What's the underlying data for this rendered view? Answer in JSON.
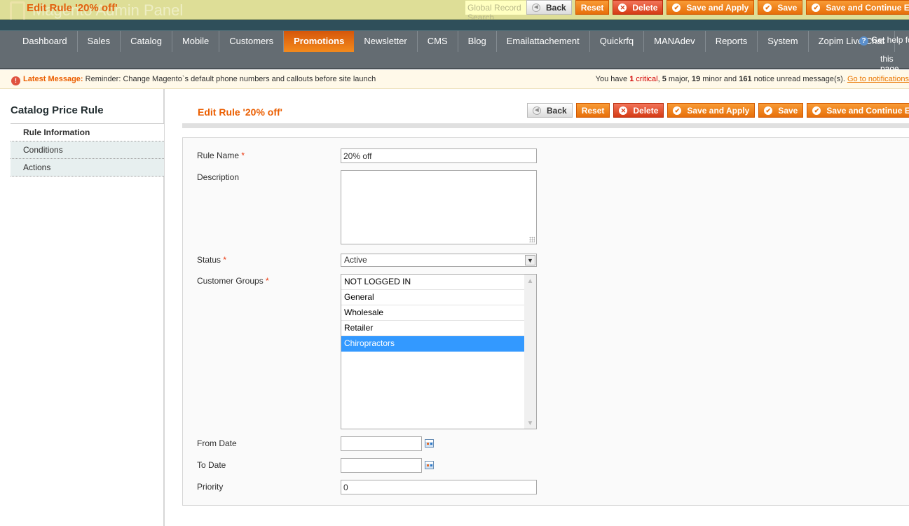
{
  "header": {
    "logo_text": "Magento Admin Panel",
    "floating_title": "Edit Rule '20% off'",
    "global_search_placeholder": "Global Record Search"
  },
  "toolbar": {
    "back": "Back",
    "reset": "Reset",
    "delete": "Delete",
    "save_apply": "Save and Apply",
    "save": "Save",
    "save_continue": "Save and Continue Edit"
  },
  "nav": {
    "items": [
      "Dashboard",
      "Sales",
      "Catalog",
      "Mobile",
      "Customers",
      "Promotions",
      "Newsletter",
      "CMS",
      "Blog",
      "Emailattachement",
      "Quickrfq",
      "MANAdev",
      "Reports",
      "System",
      "Zopim Live Chat"
    ],
    "active": "Promotions",
    "help_line1": "Get help for",
    "help_line2": "this page"
  },
  "message": {
    "label": "Latest Message:",
    "text": "Reminder: Change Magento`s default phone numbers and callouts before site launch",
    "you_have": "You have",
    "critical_count": "1",
    "critical": "critical",
    "major_count": "5",
    "major": "major,",
    "minor_count": "19",
    "minor": "minor and",
    "notice_count": "161",
    "notice": "notice unread message(s).",
    "link": "Go to notifications"
  },
  "sidebar": {
    "title": "Catalog Price Rule",
    "tabs": [
      "Rule Information",
      "Conditions",
      "Actions"
    ]
  },
  "page": {
    "title": "Edit Rule '20% off'"
  },
  "form": {
    "rule_name_label": "Rule Name",
    "rule_name": "20% off",
    "description_label": "Description",
    "description": "",
    "status_label": "Status",
    "status": "Active",
    "groups_label": "Customer Groups",
    "groups": [
      "NOT LOGGED IN",
      "General",
      "Wholesale",
      "Retailer",
      "Chiropractors"
    ],
    "groups_selected": "Chiropractors",
    "from_label": "From Date",
    "from": "",
    "to_label": "To Date",
    "to": "",
    "priority_label": "Priority",
    "priority": "0",
    "required_mark": "*"
  },
  "colors": {
    "accent": "#eb5e00",
    "nav_bg": "#646c72",
    "selected": "#3399ff"
  }
}
